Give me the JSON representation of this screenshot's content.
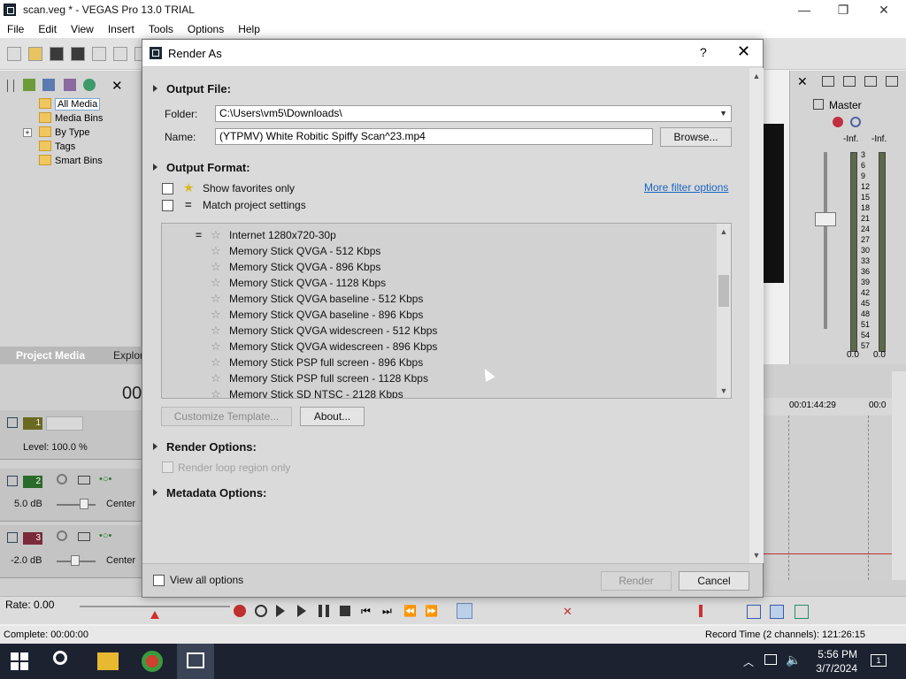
{
  "app": {
    "title": "scan.veg * - VEGAS Pro 13.0 TRIAL",
    "window_controls": {
      "minimize": "—",
      "maximize": "❐",
      "close": "✕"
    },
    "menu": [
      "File",
      "Edit",
      "View",
      "Insert",
      "Tools",
      "Options",
      "Help"
    ]
  },
  "media_panel": {
    "tree": [
      "All Media",
      "Media Bins",
      "By Type",
      "Tags",
      "Smart Bins"
    ],
    "expander": "+",
    "tabs": {
      "project_media": "Project Media",
      "explorer": "Explor"
    }
  },
  "master": {
    "title": "Master",
    "left_peak": "-Inf.",
    "right_peak": "-Inf.",
    "scale": [
      "3",
      "6",
      "9",
      "12",
      "15",
      "18",
      "21",
      "24",
      "27",
      "30",
      "33",
      "36",
      "39",
      "42",
      "45",
      "48",
      "51",
      "54",
      "57"
    ],
    "left_value": "0.0",
    "right_value": "0.0"
  },
  "timeline": {
    "time_partial": "00",
    "level_text": "Level: 100.0 %",
    "tracks": [
      {
        "number": "1"
      },
      {
        "number": "2",
        "volume": "5.0 dB",
        "pan": "Center"
      },
      {
        "number": "3",
        "volume": "-2.0 dB",
        "pan": "Center"
      }
    ],
    "ruler": {
      "t1": "00:01:44:29",
      "t2": "00:0"
    },
    "rate": "Rate: 0.00"
  },
  "status": {
    "complete": "Complete: 00:00:00",
    "record_time": "Record Time (2 channels): 121:26:15"
  },
  "taskbar": {
    "time": "5:56 PM",
    "date": "3/7/2024",
    "notification_count": "1"
  },
  "dialog": {
    "title": "Render As",
    "help": "?",
    "close": "✕",
    "output_file": {
      "heading": "Output File:",
      "folder_label": "Folder:",
      "folder_value": "C:\\Users\\vm5\\Downloads\\",
      "name_label": "Name:",
      "name_value": "(YTPMV) White Robitic Spiffy Scan^23.mp4",
      "browse": "Browse..."
    },
    "output_format": {
      "heading": "Output Format:",
      "show_favorites": "Show favorites only",
      "match_settings": "Match project settings",
      "more_filter": "More filter options",
      "templates": [
        "Internet 1280x720-30p",
        "Memory Stick QVGA - 512 Kbps",
        "Memory Stick QVGA - 896 Kbps",
        "Memory Stick QVGA - 1128 Kbps",
        "Memory Stick QVGA baseline - 512 Kbps",
        "Memory Stick QVGA baseline - 896 Kbps",
        "Memory Stick QVGA widescreen - 512 Kbps",
        "Memory Stick QVGA widescreen - 896 Kbps",
        "Memory Stick PSP full screen - 896 Kbps",
        "Memory Stick PSP full screen - 1128 Kbps",
        "Memory Stick SD NTSC - 2128 Kbps"
      ],
      "customize": "Customize Template...",
      "about": "About..."
    },
    "render_options": {
      "heading": "Render Options:",
      "loop_region": "Render loop region only"
    },
    "metadata_options": {
      "heading": "Metadata Options:"
    },
    "view_all": "View all options",
    "render": "Render",
    "cancel": "Cancel"
  }
}
